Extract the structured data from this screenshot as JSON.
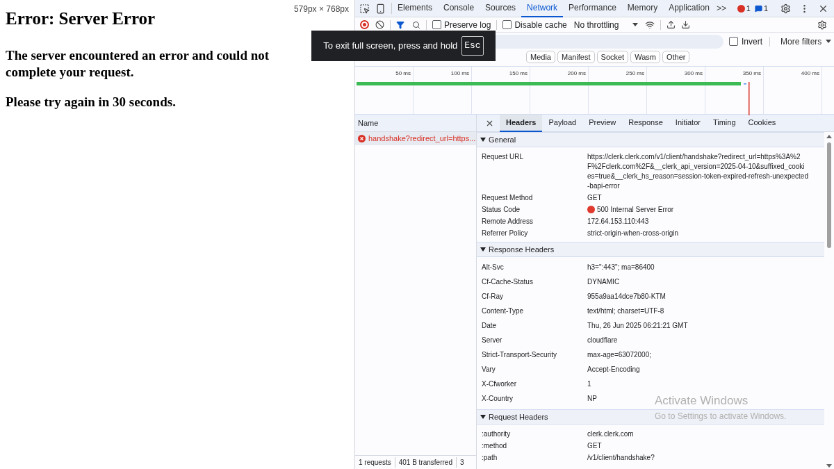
{
  "page": {
    "dimensions": "579px × 768px",
    "title": "Error: Server Error",
    "message": "The server encountered an error and could not complete your request.",
    "retry": "Please try again in 30 seconds."
  },
  "devtools": {
    "tabs": [
      {
        "label": "Elements",
        "selected": false
      },
      {
        "label": "Console",
        "selected": false
      },
      {
        "label": "Sources",
        "selected": false
      },
      {
        "label": "Network",
        "selected": true
      },
      {
        "label": "Performance",
        "selected": false
      },
      {
        "label": "Memory",
        "selected": false
      },
      {
        "label": "Application",
        "selected": false
      }
    ],
    "more_tabs": ">>",
    "error_count": "1",
    "message_count": "1",
    "toolbar": {
      "recording": true,
      "preserve_log": {
        "label": "Preserve log",
        "checked": false
      },
      "disable_cache": {
        "label": "Disable cache",
        "checked": false
      },
      "throttling": "No throttling"
    },
    "filter": {
      "invert": {
        "label": "Invert",
        "checked": false
      },
      "more_filters": "More filters"
    },
    "chips": [
      {
        "label": "Media",
        "selected": false
      },
      {
        "label": "Manifest",
        "selected": false
      },
      {
        "label": "Socket",
        "selected": false
      },
      {
        "label": "Wasm",
        "selected": false
      },
      {
        "label": "Other",
        "selected": false
      }
    ],
    "timeline": {
      "ticks": [
        "50 ms",
        "100 ms",
        "150 ms",
        "200 ms",
        "250 ms",
        "300 ms",
        "350 ms",
        "400 ms"
      ]
    },
    "requests": {
      "column": "Name",
      "rows": [
        {
          "name": "handshake?redirect_url=https...",
          "failed": true,
          "selected": true
        }
      ]
    },
    "detail_tabs": [
      {
        "label": "Headers",
        "selected": true
      },
      {
        "label": "Payload",
        "selected": false
      },
      {
        "label": "Preview",
        "selected": false
      },
      {
        "label": "Response",
        "selected": false
      },
      {
        "label": "Initiator",
        "selected": false
      },
      {
        "label": "Timing",
        "selected": false
      },
      {
        "label": "Cookies",
        "selected": false
      }
    ],
    "sections": [
      {
        "title": "General",
        "expanded": true,
        "compact": true,
        "rows": [
          {
            "key": "Request URL",
            "value": "https://clerk.clerk.com/v1/client/handshake?redirect_url=https%3A%2F%2Fclerk.com%2F&__clerk_api_version=2025-04-10&suffixed_cookies=true&__clerk_hs_reason=session-token-expired-refresh-unexpected-bapi-error"
          },
          {
            "key": "Request Method",
            "value": "GET"
          },
          {
            "key": "Status Code",
            "value": "500 Internal Server Error",
            "color": "#e03a2f"
          },
          {
            "key": "Remote Address",
            "value": "172.64.153.110:443"
          },
          {
            "key": "Referrer Policy",
            "value": "strict-origin-when-cross-origin"
          }
        ]
      },
      {
        "title": "Response Headers",
        "expanded": true,
        "compact": false,
        "rows": [
          {
            "key": "Alt-Svc",
            "value": "h3=\":443\"; ma=86400"
          },
          {
            "key": "Cf-Cache-Status",
            "value": "DYNAMIC"
          },
          {
            "key": "Cf-Ray",
            "value": "955a9aa14dce7b80-KTM"
          },
          {
            "key": "Content-Type",
            "value": "text/html; charset=UTF-8"
          },
          {
            "key": "Date",
            "value": "Thu, 26 Jun 2025 06:21:21 GMT"
          },
          {
            "key": "Server",
            "value": "cloudflare"
          },
          {
            "key": "Strict-Transport-Security",
            "value": "max-age=63072000;"
          },
          {
            "key": "Vary",
            "value": "Accept-Encoding"
          },
          {
            "key": "X-Cfworker",
            "value": "1"
          },
          {
            "key": "X-Country",
            "value": "NP"
          }
        ]
      },
      {
        "title": "Request Headers",
        "expanded": true,
        "compact": true,
        "rows": [
          {
            "key": ":authority",
            "value": "clerk.clerk.com"
          },
          {
            "key": ":method",
            "value": "GET"
          },
          {
            "key": ":path",
            "value": "/v1/client/handshake?"
          }
        ]
      }
    ],
    "status_bar": [
      "1 requests",
      "401 B transferred",
      "3"
    ]
  },
  "toast": {
    "text": "To exit full screen, press and hold",
    "key": "Esc"
  },
  "os_notice": {
    "title": "Activate Windows",
    "subtitle": "Go to Settings to activate Windows."
  }
}
